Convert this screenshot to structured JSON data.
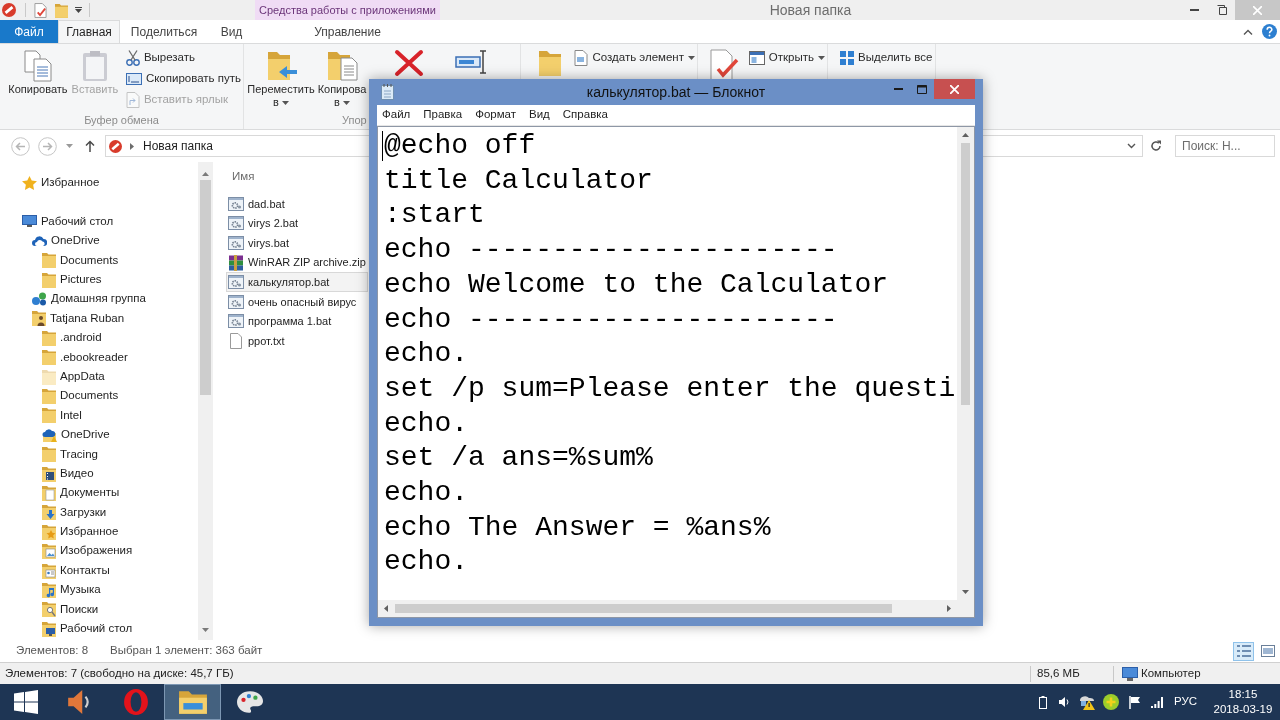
{
  "explorer": {
    "title": "Новая папка",
    "context_tabs": {
      "group": "Средства работы с приложениями",
      "tabs": [
        {
          "label": "Управление",
          "selected": false
        }
      ]
    },
    "file_tab": "Файл",
    "tabs": [
      {
        "label": "Главная",
        "selected": true
      },
      {
        "label": "Поделиться",
        "selected": false
      },
      {
        "label": "Вид",
        "selected": false
      }
    ],
    "ribbon": {
      "groups": [
        {
          "label": "Буфер обмена",
          "buttons": [
            {
              "label": "Копировать",
              "kind": "large",
              "disabled": false,
              "dropdown": false
            },
            {
              "label": "Вставить",
              "kind": "large",
              "disabled": true,
              "dropdown": false
            },
            {
              "label": "Вырезать",
              "kind": "small",
              "disabled": false,
              "dropdown": false
            },
            {
              "label": "Скопировать путь",
              "kind": "small",
              "disabled": false,
              "dropdown": false
            },
            {
              "label": "Вставить ярлык",
              "kind": "small",
              "disabled": true,
              "dropdown": false
            }
          ]
        },
        {
          "label": "Упор",
          "buttons": [
            {
              "label": "Переместить в",
              "kind": "large",
              "disabled": false,
              "dropdown": true
            },
            {
              "label": "Копирова в",
              "kind": "large",
              "disabled": false,
              "dropdown": true
            },
            {
              "kind": "icon",
              "disabled": false,
              "dropdown": false
            },
            {
              "kind": "icon",
              "disabled": false,
              "dropdown": false
            }
          ]
        },
        {
          "buttons": [
            {
              "kind": "icon",
              "disabled": false,
              "dropdown": false
            },
            {
              "label": "Создать элемент",
              "kind": "small",
              "disabled": false,
              "dropdown": true
            }
          ]
        },
        {
          "buttons": [
            {
              "kind": "icon",
              "disabled": false,
              "dropdown": false
            },
            {
              "label": "Открыть",
              "kind": "small",
              "disabled": false,
              "dropdown": true
            }
          ]
        },
        {
          "buttons": [
            {
              "label": "Выделить все",
              "kind": "small",
              "disabled": false,
              "dropdown": false
            }
          ]
        }
      ]
    },
    "address_bar": {
      "path": "Новая папка"
    },
    "search": {
      "placeholder": "Поиск: Н..."
    },
    "nav_pane": {
      "items": [
        {
          "label": "Избранное",
          "kind": "favorites"
        },
        {
          "label": "Рабочий стол",
          "kind": "desktop",
          "children": [
            {
              "label": "OneDrive",
              "kind": "cloud",
              "children": [
                {
                  "label": "Documents",
                  "kind": "folder"
                },
                {
                  "label": "Pictures",
                  "kind": "folder"
                }
              ]
            },
            {
              "label": "Домашняя группа",
              "kind": "homegroup"
            },
            {
              "label": "Tatjana Ruban",
              "kind": "user",
              "children": [
                {
                  "label": ".android",
                  "kind": "folder"
                },
                {
                  "label": ".ebookreader",
                  "kind": "folder"
                },
                {
                  "label": "AppData",
                  "kind": "hidden_folder"
                },
                {
                  "label": "Documents",
                  "kind": "folder"
                },
                {
                  "label": "Intel",
                  "kind": "folder"
                },
                {
                  "label": "OneDrive",
                  "kind": "cloud_folder"
                },
                {
                  "label": "Tracing",
                  "kind": "folder"
                },
                {
                  "label": "Видео",
                  "kind": "video_folder"
                },
                {
                  "label": "Документы",
                  "kind": "documents_folder"
                },
                {
                  "label": "Загрузки",
                  "kind": "downloads_folder"
                },
                {
                  "label": "Избранное",
                  "kind": "favorites_folder"
                },
                {
                  "label": "Изображения",
                  "kind": "pictures_folder"
                },
                {
                  "label": "Контакты",
                  "kind": "contacts_folder"
                },
                {
                  "label": "Музыка",
                  "kind": "music_folder"
                },
                {
                  "label": "Поиски",
                  "kind": "searches_folder"
                },
                {
                  "label": "Рабочий стол",
                  "kind": "desktop_folder"
                }
              ]
            }
          ]
        }
      ]
    },
    "file_list": {
      "column_header": "Имя",
      "rows": [
        {
          "name": "dad.bat",
          "kind": "script",
          "selected": false
        },
        {
          "name": "virys 2.bat",
          "kind": "script",
          "selected": false
        },
        {
          "name": "virys.bat",
          "kind": "script",
          "selected": false
        },
        {
          "name": "WinRAR ZIP archive.zip",
          "kind": "archive",
          "selected": false
        },
        {
          "name": "калькулятор.bat",
          "kind": "script",
          "selected": true
        },
        {
          "name": "очень опасный вирус",
          "kind": "script",
          "selected": false
        },
        {
          "name": "программа 1.bat",
          "kind": "script",
          "selected": false
        },
        {
          "name": "ррот.txt",
          "kind": "text",
          "selected": false
        }
      ]
    },
    "status_bar": {
      "item_count": "Элементов: 8",
      "selection": "Выбран 1 элемент: 363 байт",
      "views": [
        {
          "kind": "details",
          "selected": true
        },
        {
          "kind": "tiles",
          "selected": false
        }
      ]
    },
    "bottom_status_bar": {
      "items": "Элементов: 7 (свободно на диске: 45,7 ГБ)",
      "size": "85,6 МБ",
      "zone": "Компьютер"
    }
  },
  "notepad": {
    "title": "калькулятор.bat — Блокнот",
    "menu": [
      "Файл",
      "Правка",
      "Формат",
      "Вид",
      "Справка"
    ],
    "lines": [
      "@echo off",
      "title Calculator",
      ":start",
      "echo ----------------------",
      "echo Welcome to the Calculator",
      "echo ----------------------",
      "echo.",
      "set /p sum=Please enter the questi",
      "echo.",
      "set /a ans=%sum%",
      "echo.",
      "echo The Answer = %ans%",
      "echo."
    ]
  },
  "taskbar": {
    "apps": [
      {
        "kind": "media",
        "active": false
      },
      {
        "kind": "browser",
        "active": false
      },
      {
        "kind": "explorer",
        "active": true
      },
      {
        "kind": "paint",
        "active": false
      }
    ],
    "language": "РУС",
    "time": "18:15",
    "date": "2018-03-19"
  }
}
